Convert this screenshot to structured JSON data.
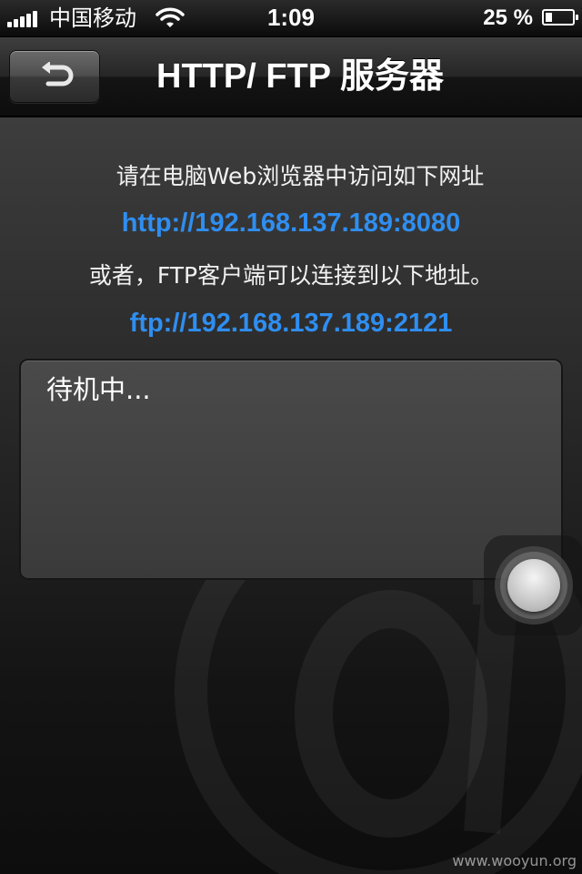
{
  "status_bar": {
    "carrier": "中国移动",
    "time": "1:09",
    "battery_percent": "25 %",
    "battery_level": 0.25,
    "signal_bars": 5
  },
  "nav": {
    "title": "HTTP/ FTP 服务器",
    "back_icon": "back-arrow-icon"
  },
  "content": {
    "http_instruction": "请在电脑Web浏览器中访问如下网址",
    "http_url": "http://192.168.137.189:8080",
    "ftp_instruction": "或者，FTP客户端可以连接到以下地址。",
    "ftp_url": "ftp://192.168.137.189:2121",
    "status_text": "待机中...",
    "watermark_icon": "at-sign-icon"
  },
  "overlay": {
    "assistive_touch_icon": "assistive-touch-icon",
    "site_watermark": "www.wooyun.org"
  },
  "colors": {
    "link": "#2f8ef0",
    "nav_background": "#1a1a1a",
    "text": "#ffffff"
  }
}
